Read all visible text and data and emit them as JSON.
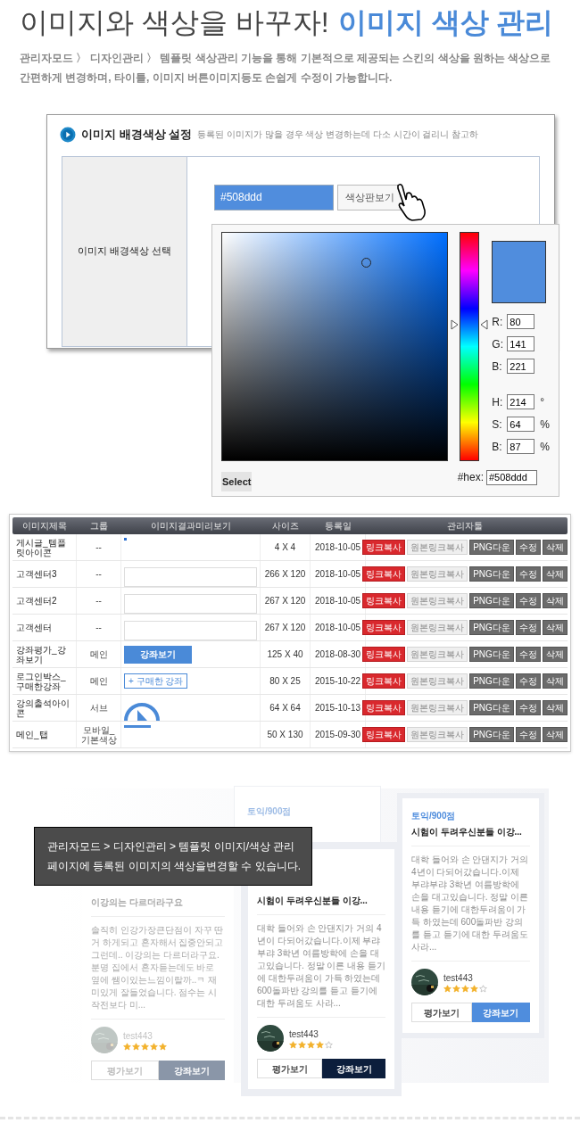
{
  "header": {
    "title": "이미지와 색상을 바꾸자!",
    "title_highlight": "이미지 색상 관리",
    "description": "관리자모드 〉 디자인관리 〉 템플릿 색상관리 기능을 통해 기본적으로 제공되는 스킨의 색상을 원하는 색상으로 간편하게 변경하며, 타이틀, 이미지 버튼이미지등도 손쉽게 수정이 가능합니다."
  },
  "settings_window": {
    "title": "이미지 배경색상 설정",
    "note": "등록된 이미지가 많을 경우 색상 변경하는데 다소 시간이 걸리니 참고하",
    "field_label": "이미지 배경색상 선택",
    "color_value": "#508ddd",
    "palette_button": "색상판보기"
  },
  "color_picker": {
    "groups": [
      {
        "fields": [
          {
            "label": "R:",
            "value": "80"
          },
          {
            "label": "G:",
            "value": "141"
          },
          {
            "label": "B:",
            "value": "221"
          }
        ]
      },
      {
        "fields": [
          {
            "label": "H:",
            "value": "214",
            "unit": "°"
          },
          {
            "label": "S:",
            "value": "64",
            "unit": "%"
          },
          {
            "label": "B:",
            "value": "87",
            "unit": "%"
          }
        ]
      }
    ],
    "hex_label": "#hex:",
    "hex_value": "#508ddd",
    "select_button": "Select"
  },
  "table": {
    "columns": [
      "이미지제목",
      "그룹",
      "이미지결과미리보기",
      "사이즈",
      "등록일",
      "관리자툴"
    ],
    "rows": [
      {
        "title": "게시글_템플릿아이콘",
        "group": "--",
        "preview": {
          "kind": "dot"
        },
        "size": "4 X 4",
        "date": "2018-10-05",
        "actions": [
          "링크복사",
          "원본링크복사",
          "PNG다운",
          "수정",
          "삭제"
        ]
      },
      {
        "title": "고객센터3",
        "group": "--",
        "preview": {
          "kind": "banner"
        },
        "size": "266 X 120",
        "date": "2018-10-05",
        "actions": [
          "링크복사",
          "원본링크복사",
          "PNG다운",
          "수정",
          "삭제"
        ]
      },
      {
        "title": "고객센터2",
        "group": "--",
        "preview": {
          "kind": "banner"
        },
        "size": "267 X 120",
        "date": "2018-10-05",
        "actions": [
          "링크복사",
          "원본링크복사",
          "PNG다운",
          "수정",
          "삭제"
        ]
      },
      {
        "title": "고객센터",
        "group": "--",
        "preview": {
          "kind": "banner"
        },
        "size": "267 X 120",
        "date": "2018-10-05",
        "actions": [
          "링크복사",
          "원본링크복사",
          "PNG다운",
          "수정",
          "삭제"
        ]
      },
      {
        "title": "강좌평가_강좌보기",
        "group": "메인",
        "preview": {
          "kind": "button",
          "text": "강좌보기"
        },
        "size": "125 X 40",
        "date": "2018-08-30",
        "actions": [
          "링크복사",
          "원본링크복사",
          "PNG다운",
          "수정",
          "삭제"
        ]
      },
      {
        "title": "로그인박스_구매한강좌",
        "group": "메인",
        "preview": {
          "kind": "outline-button",
          "text": "+ 구매한 강좌"
        },
        "size": "80 X 25",
        "date": "2015-10-22",
        "actions": [
          "링크복사",
          "원본링크복사",
          "PNG다운",
          "수정",
          "삭제"
        ]
      },
      {
        "title": "강의출석아이콘",
        "group": "서브",
        "preview": {
          "kind": "play-icon"
        },
        "size": "64 X 64",
        "date": "2015-10-13",
        "actions": [
          "링크복사",
          "원본링크복사",
          "PNG다운",
          "수정",
          "삭제"
        ]
      },
      {
        "title": "메인_탭",
        "group": "모바일_기본색상",
        "preview": {
          "kind": "bar"
        },
        "size": "50 X 130",
        "date": "2015-09-30",
        "actions": [
          "링크복사",
          "원본링크복사",
          "PNG다운",
          "수정",
          "삭제"
        ]
      }
    ]
  },
  "notice": {
    "lines": [
      "관리자모드 > 디자인관리 > 템플릿 이미지/색상 관리",
      "페이지에 등록된 이미지의 색상을변경할 수 있습니다."
    ]
  },
  "cards": [
    {
      "kind": "back",
      "category": "토익/900점"
    },
    {
      "kind": "faded",
      "title": "이강의는 다르더라구요",
      "body": "솔직히 인강가장큰단점이 자꾸 딴거 하게되고 혼자해서 집중안되고 그런데.. 이강의는 다르더라구요. 분명 집에서 혼자듣는데도 바로 옆에 쌤이있는느낌이랄까..ㅋ 재미있게 잘들었습니다. 점수는 시작전보다 미...",
      "user": "test443",
      "stars": 5,
      "buttons": [
        "평가보기",
        "강좌보기"
      ],
      "color": "#8a96a8"
    },
    {
      "kind": "front",
      "title": "시험이 두려우신분들 이강...",
      "body": "대학 들어와 손 안댄지가 거의 4년이 다되어갔습니다.이제 부랴부랴 3학년 여름방학에 손을 대고있습니다. 정말 이른 내용 듣기에 대한두려움이 가득 하였는데 600돌파반 강의를 듣고 듣기에 대한 두려움도 사라...",
      "user": "test443",
      "stars": 4,
      "buttons": [
        "평가보기",
        "강좌보기"
      ],
      "color": "#0c1e3c"
    },
    {
      "kind": "right",
      "category": "토익/900점",
      "title": "시험이 두려우신분들 이강...",
      "body": "대학 들어와 손 안댄지가 거의 4년이 다되어갔습니다.이제 부랴부랴 3학년 여름방학에 손을 대고있습니다. 정말 이른 내용 듣기에 대한두려움이 가득 하였는데 600돌파반 강의를 듣고 듣기에 대한 두려움도 사라...",
      "user": "test443",
      "stars": 4,
      "buttons": [
        "평가보기",
        "강좌보기"
      ],
      "color": "#4f8ddd"
    }
  ]
}
